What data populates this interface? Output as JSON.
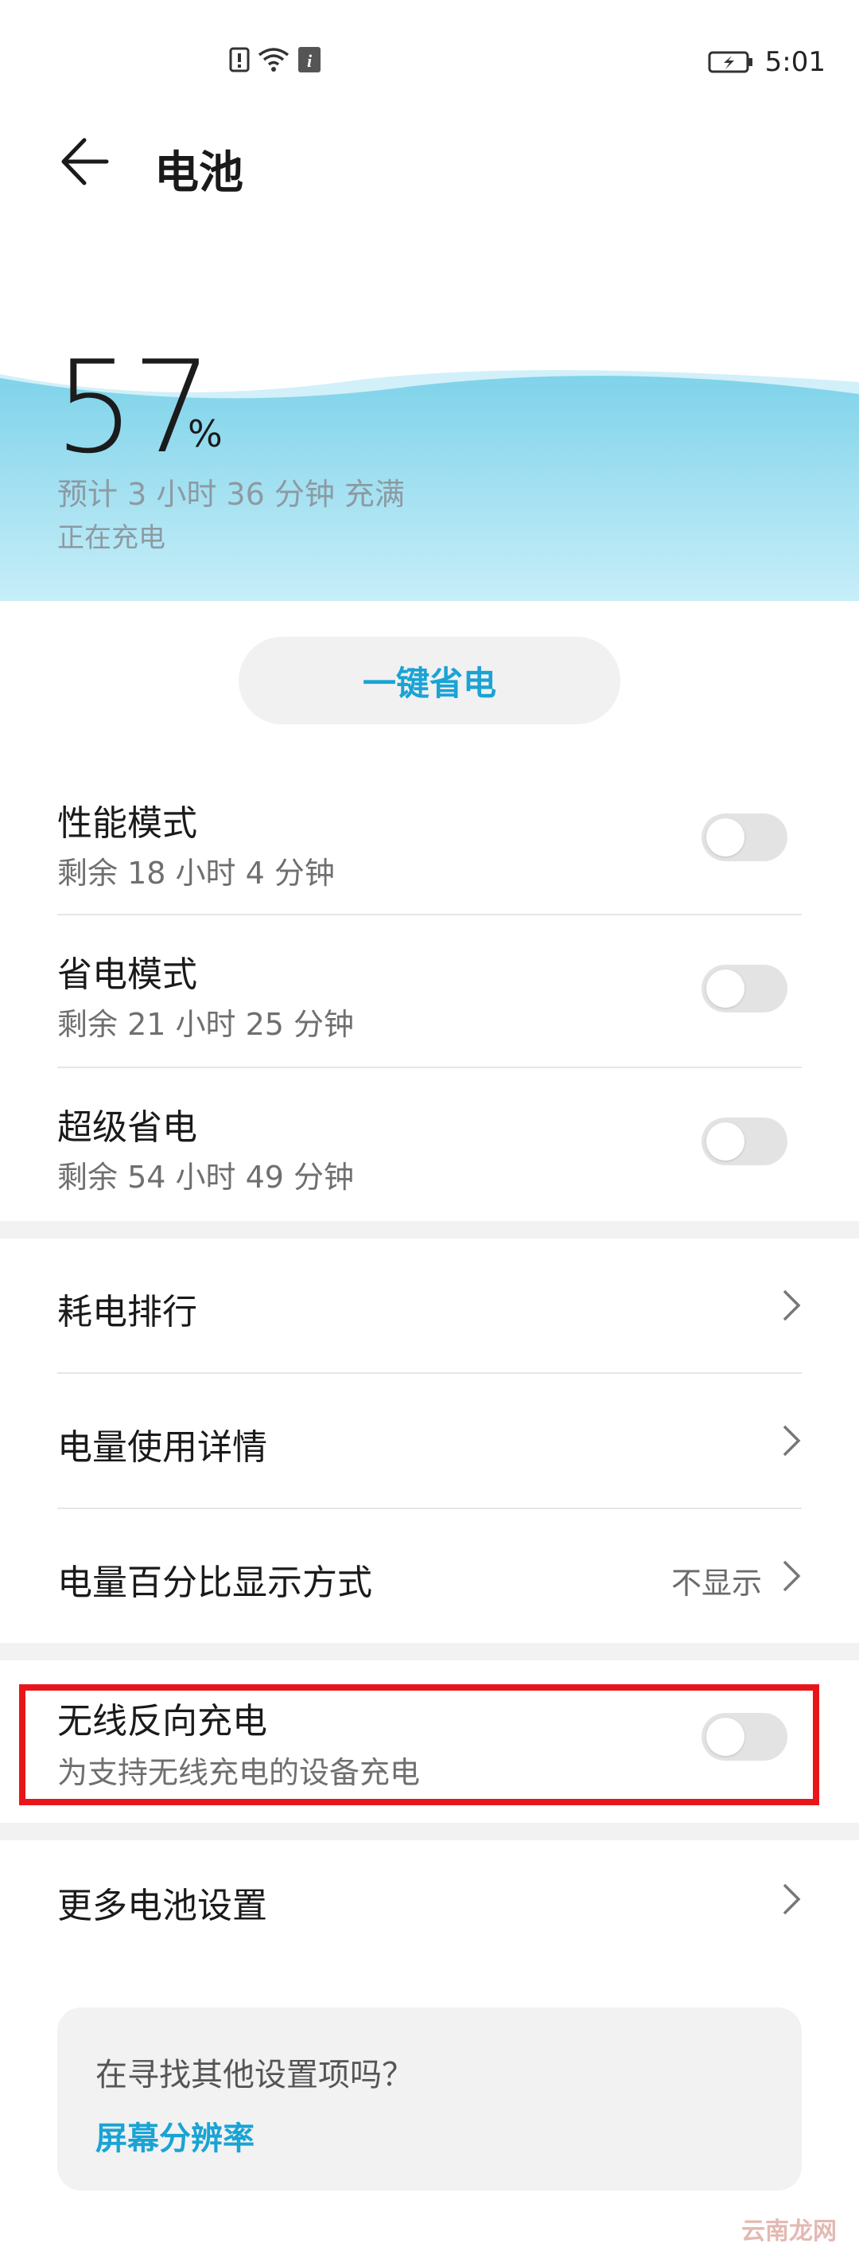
{
  "status": {
    "time": "5:01"
  },
  "header": {
    "title": "电池"
  },
  "battery": {
    "percent": "57",
    "percent_sign": "%",
    "eta": "预计 3 小时 36 分钟 充满",
    "state": "正在充电"
  },
  "save_button": "一键省电",
  "modes": [
    {
      "title": "性能模式",
      "sub": "剩余 18 小时 4 分钟",
      "on": false
    },
    {
      "title": "省电模式",
      "sub": "剩余 21 小时 25 分钟",
      "on": false
    },
    {
      "title": "超级省电",
      "sub": "剩余 54 小时 49 分钟",
      "on": false
    }
  ],
  "links": [
    {
      "title": "耗电排行"
    },
    {
      "title": "电量使用详情"
    },
    {
      "title": "电量百分比显示方式",
      "value": "不显示"
    }
  ],
  "reverse_charge": {
    "title": "无线反向充电",
    "sub": "为支持无线充电的设备充电",
    "on": false
  },
  "more": {
    "title": "更多电池设置"
  },
  "tip": {
    "question": "在寻找其他设置项吗？",
    "link": "屏幕分辨率"
  },
  "watermark": "云南龙网",
  "colors": {
    "accent": "#1aa3d4",
    "highlight_border": "#e8161a",
    "wave": "#8ad8ec"
  }
}
